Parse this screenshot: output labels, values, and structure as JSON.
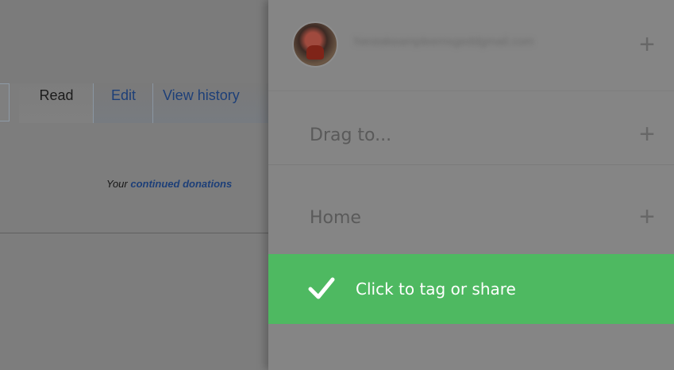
{
  "background_page": {
    "tabs": {
      "read": "Read",
      "edit": "Edit",
      "view_history": "View history"
    },
    "donation_notice": {
      "prefix": "Your ",
      "link": "continued donations"
    }
  },
  "panel": {
    "account": {
      "email": "hiestakeampleemsgeddgmail.com",
      "add_icon": "+"
    },
    "rows": {
      "drag_label": "Drag to...",
      "home_label": "Home",
      "add_icon": "+"
    },
    "tag_share": {
      "label": "Click to tag or share"
    }
  },
  "colors": {
    "tag_bar": "#4eb961",
    "accent_blue": "#1f5d96",
    "accent_gray": "#4b4e52"
  },
  "icons": [
    "check-icon",
    "plus-icon",
    "avatar"
  ]
}
